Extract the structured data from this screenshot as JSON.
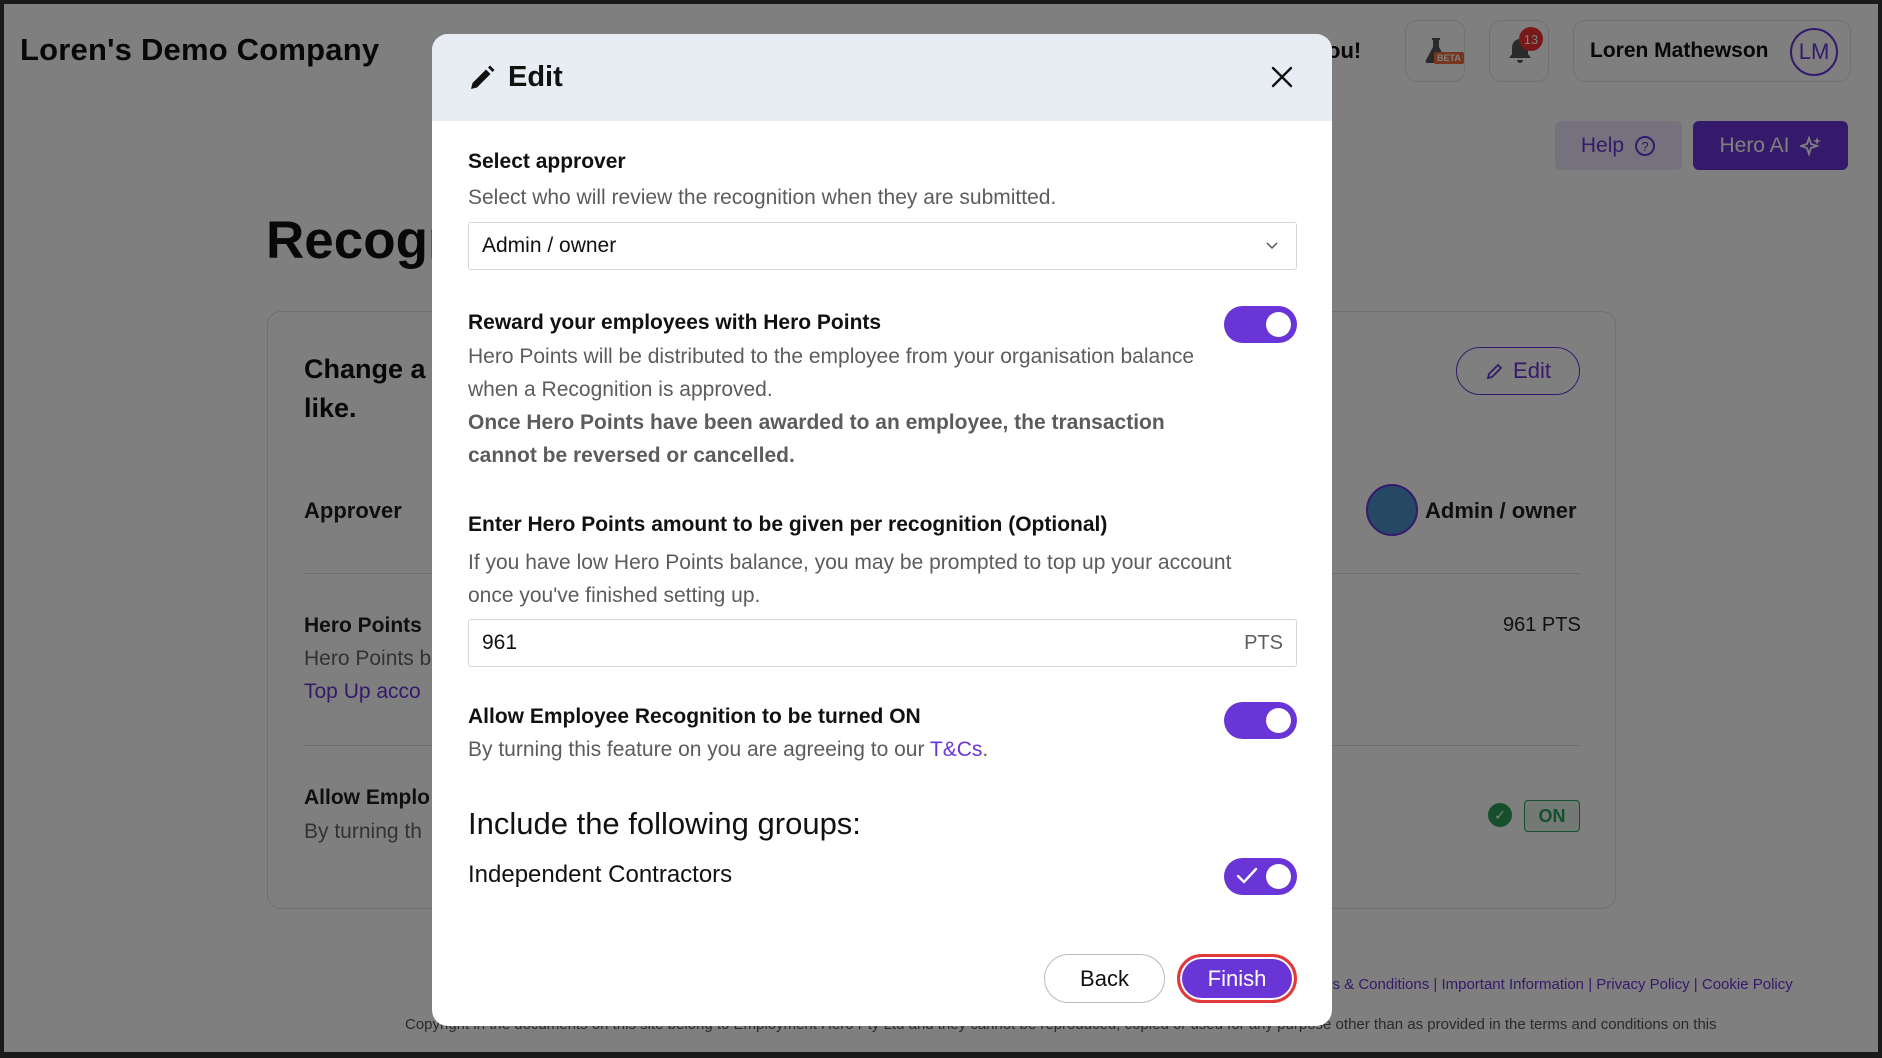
{
  "page": {
    "company_name": "Loren's Demo Company",
    "top_tail_text": "ou!",
    "beta_label": "BETA",
    "notification_count": "13",
    "user_name": "Loren Mathewson",
    "user_initials": "LM",
    "help_label": "Help",
    "hero_ai_label": "Hero AI",
    "title": "Recogn",
    "card_heading": "Change a like.",
    "edit_label": "Edit",
    "approver_label": "Approver",
    "approver_value": "Admin / owner",
    "hero_points_label": "Hero Points",
    "hero_points_sub": "Hero Points b",
    "top_up_link": "Top Up acco",
    "points_value": "961 PTS",
    "allow_label": "Allow Emplo",
    "allow_sub": "By turning th",
    "on_badge": "ON",
    "footer_links": [
      "ms & Conditions",
      "Important Information",
      "Privacy Policy",
      "Cookie Policy"
    ],
    "footer_copyright": "Copyright in the documents on this site belong to Employment Hero Pty Ltd and they cannot be reproduced, copied or used for any purpose other than as provided in the terms and conditions on this"
  },
  "modal": {
    "title": "Edit",
    "select_approver_label": "Select approver",
    "select_approver_help": "Select who will review the recognition when they are submitted.",
    "approver_selected": "Admin / owner",
    "reward_label": "Reward your employees with Hero Points",
    "reward_enabled": true,
    "reward_help_1": "Hero Points will be distributed to the employee from your organisation balance when a Recognition is approved.",
    "reward_help_2": "Once Hero Points have been awarded to an employee, the transaction cannot be reversed or cancelled.",
    "amount_label": "Enter Hero Points amount to be given per recognition (Optional)",
    "amount_help": "If you have low Hero Points balance, you may be prompted to top up your account once you've finished setting up.",
    "amount_value": "961",
    "amount_unit": "PTS",
    "allow_label": "Allow Employee Recognition to be turned ON",
    "allow_enabled": true,
    "allow_help_prefix": "By turning this feature on you are agreeing to our ",
    "allow_help_link": "T&Cs",
    "allow_help_suffix": ".",
    "groups_heading": "Include the following groups:",
    "group_name": "Independent Contractors",
    "group_enabled": true,
    "back_label": "Back",
    "finish_label": "Finish"
  },
  "colors": {
    "accent": "#6a35d6",
    "success": "#2e9e5b",
    "highlight": "#e23a3a"
  }
}
